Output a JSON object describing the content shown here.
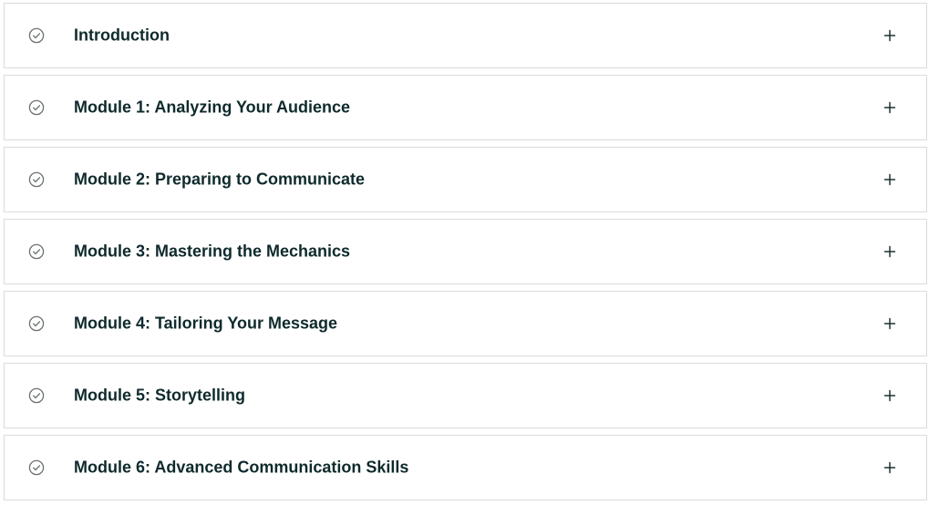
{
  "accordion": {
    "items": [
      {
        "label": "Introduction",
        "status_icon": "check-circle-icon",
        "toggle_icon": "plus-icon",
        "expanded": false
      },
      {
        "label": "Module 1: Analyzing Your Audience",
        "status_icon": "check-circle-icon",
        "toggle_icon": "plus-icon",
        "expanded": false
      },
      {
        "label": "Module 2: Preparing to Communicate",
        "status_icon": "check-circle-icon",
        "toggle_icon": "plus-icon",
        "expanded": false
      },
      {
        "label": "Module 3: Mastering the Mechanics",
        "status_icon": "check-circle-icon",
        "toggle_icon": "plus-icon",
        "expanded": false
      },
      {
        "label": "Module 4: Tailoring Your Message",
        "status_icon": "check-circle-icon",
        "toggle_icon": "plus-icon",
        "expanded": false
      },
      {
        "label": "Module 5: Storytelling",
        "status_icon": "check-circle-icon",
        "toggle_icon": "plus-icon",
        "expanded": false
      },
      {
        "label": "Module 6: Advanced Communication Skills",
        "status_icon": "check-circle-icon",
        "toggle_icon": "plus-icon",
        "expanded": false
      }
    ]
  },
  "colors": {
    "title_text": "#0f2a2c",
    "border": "#d9dcdc",
    "check_icon": "#6b7272",
    "plus_icon": "#1f3234",
    "background": "#ffffff"
  }
}
